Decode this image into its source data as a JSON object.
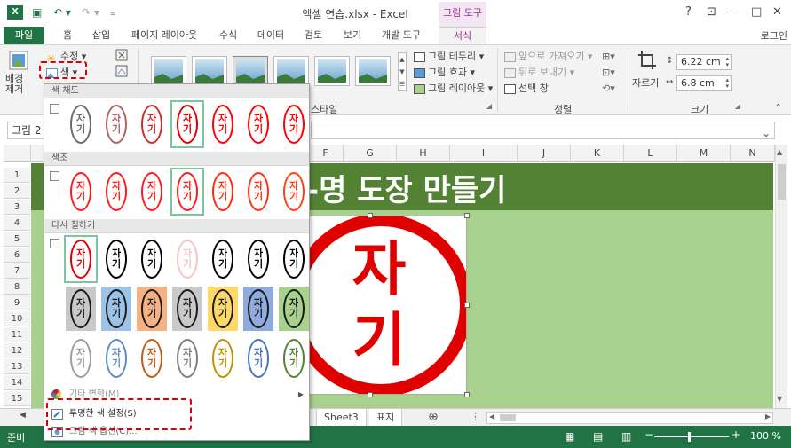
{
  "window": {
    "title": "엑셀 연습.xlsx - Excel",
    "tool_context": "그림 도구",
    "app_badge": "X",
    "qat": [
      "▣",
      "↶ ▾",
      "↷ ▾",
      "₌"
    ],
    "controls": [
      "?",
      "⊡",
      "–",
      "□",
      "✕"
    ]
  },
  "tabs": {
    "file": "파일",
    "items": [
      "홈",
      "삽입",
      "페이지 레이아웃",
      "수식",
      "데이터",
      "검토",
      "보기",
      "개발 도구",
      "서식"
    ],
    "active": "서식",
    "login": "로그인"
  },
  "ribbon": {
    "remove_bg": "배경\n제거",
    "corrections": "수정 ▾",
    "color": "색 ▾",
    "border": "그림 테두리 ▾",
    "effects": "그림 효과 ▾",
    "layout": "그림 레이아웃 ▾",
    "styles_label": "스타일",
    "bring_forward": "앞으로 가져오기 ▾",
    "send_backward": "뒤로 보내기 ▾",
    "selection_pane": "선택 창",
    "arrange_label": "정렬",
    "crop": "자르기",
    "height": "6.22 cm",
    "width": "6.8 cm",
    "size_label": "크기"
  },
  "formula_bar": {
    "name_box": "그림 2"
  },
  "grid": {
    "columns": [
      "F",
      "G",
      "H",
      "I",
      "J",
      "K",
      "L",
      "M",
      "N"
    ],
    "rows": [
      "1",
      "2",
      "3",
      "4",
      "5",
      "6",
      "7",
      "8",
      "9",
      "10",
      "11",
      "12",
      "13",
      "14",
      "15"
    ],
    "title_text": "-명 도장 만들기",
    "stamp_text": "자\n기"
  },
  "sheets": {
    "tabs": [
      "Sheet3",
      "표지"
    ],
    "add": "⊕"
  },
  "status": {
    "ready": "준비",
    "zoom": "100 %",
    "view_icons": [
      "▦",
      "▤",
      "▥"
    ],
    "zoom_minus": "−",
    "zoom_plus": "+"
  },
  "color_dropdown": {
    "saturation_label": "색 채도",
    "tone_label": "색조",
    "recolor_label": "다시 칠하기",
    "more_variations": "기타 변형(M)",
    "set_transparent": "투명한 색 설정(S)",
    "picture_color_options": "그림 색 옵션(C)...",
    "stamp_char": "자\n기",
    "saturation_colors": [
      "#6a6a6a",
      "#b46060",
      "#d22a2a",
      "#e00000",
      "#ff0000",
      "#ff0000",
      "#ff0000"
    ],
    "tone_colors": [
      "#ff1a1a",
      "#ff1a1a",
      "#ff1a1a",
      "#ff1a1a",
      "#ff2a10",
      "#ff3010",
      "#ff4010"
    ],
    "recolor_row1": [
      {
        "ink": "#e00000",
        "bg": "#ffffff"
      },
      {
        "ink": "#000000",
        "bg": "#ffffff"
      },
      {
        "ink": "#000000",
        "bg": "#ffffff"
      },
      {
        "ink": "#f5c5c5",
        "bg": "#ffffff"
      },
      {
        "ink": "#000000",
        "bg": "#ffffff"
      },
      {
        "ink": "#000000",
        "bg": "#ffffff"
      },
      {
        "ink": "#000000",
        "bg": "#ffffff"
      }
    ],
    "recolor_row2": [
      {
        "ink": "#1a1a1a",
        "bg": "#c8c8c8"
      },
      {
        "ink": "#1a1a1a",
        "bg": "#9cc3e6"
      },
      {
        "ink": "#1a1a1a",
        "bg": "#f4b183"
      },
      {
        "ink": "#1a1a1a",
        "bg": "#c9c9c9"
      },
      {
        "ink": "#1a1a1a",
        "bg": "#ffd966"
      },
      {
        "ink": "#1a1a1a",
        "bg": "#8faadc"
      },
      {
        "ink": "#1a1a1a",
        "bg": "#a9d18e"
      }
    ],
    "recolor_row3": [
      {
        "ink": "#9e9e9e",
        "bg": "#ffffff"
      },
      {
        "ink": "#5b8bc5",
        "bg": "#ffffff"
      },
      {
        "ink": "#c55a11",
        "bg": "#ffffff"
      },
      {
        "ink": "#7f7f7f",
        "bg": "#ffffff"
      },
      {
        "ink": "#bf9000",
        "bg": "#ffffff"
      },
      {
        "ink": "#4472c4",
        "bg": "#ffffff"
      },
      {
        "ink": "#548235",
        "bg": "#ffffff"
      }
    ]
  },
  "colors": {
    "excel_green": "#217346",
    "title_band": "#548235",
    "light_green": "#a9d18e",
    "stamp_red": "#e00000",
    "highlight_dash": "#e00000"
  }
}
